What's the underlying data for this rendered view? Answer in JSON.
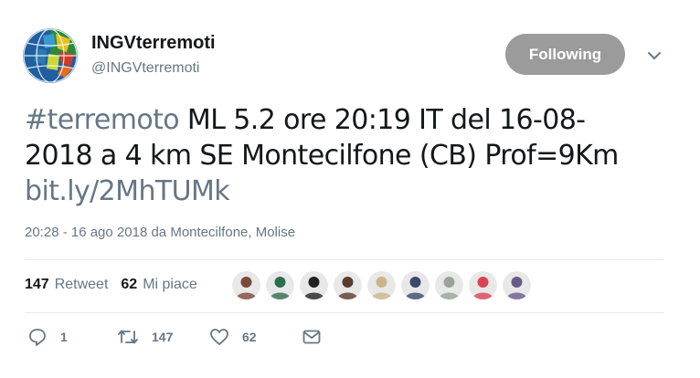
{
  "account": {
    "name": "INGVterremoti",
    "handle": "@INGVterremoti"
  },
  "follow_button": {
    "label": "Following"
  },
  "tweet": {
    "hashtag": "#terremoto",
    "text_line1_rest": " ML 5.2 ore 20:19 IT del 16-08-",
    "text_line2": "2018 a 4 km SE Montecilfone (CB) Prof=9Km",
    "link": "bit.ly/2MhTUMk"
  },
  "meta": {
    "timestamp": "20:28 - 16 ago 2018",
    "location_prefix": " da ",
    "location": "Montecilfone, Molise"
  },
  "stats": {
    "retweet_count": "147",
    "retweet_label": "Retweet",
    "like_count": "62",
    "like_label": "Mi piace"
  },
  "likers": [
    {
      "color": "#7a4a3a"
    },
    {
      "color": "#2f6e4a"
    },
    {
      "color": "#222222"
    },
    {
      "color": "#5b3b2a"
    },
    {
      "color": "#c9b58a"
    },
    {
      "color": "#3b4a6a"
    },
    {
      "color": "#9aa39a"
    },
    {
      "color": "#d94455"
    },
    {
      "color": "#6a5a8a"
    }
  ],
  "actions": {
    "reply_count": "1",
    "retweet_count": "147",
    "like_count": "62"
  },
  "colors": {
    "accent_gray": "#657786",
    "button_gray": "#9b9b9b"
  }
}
